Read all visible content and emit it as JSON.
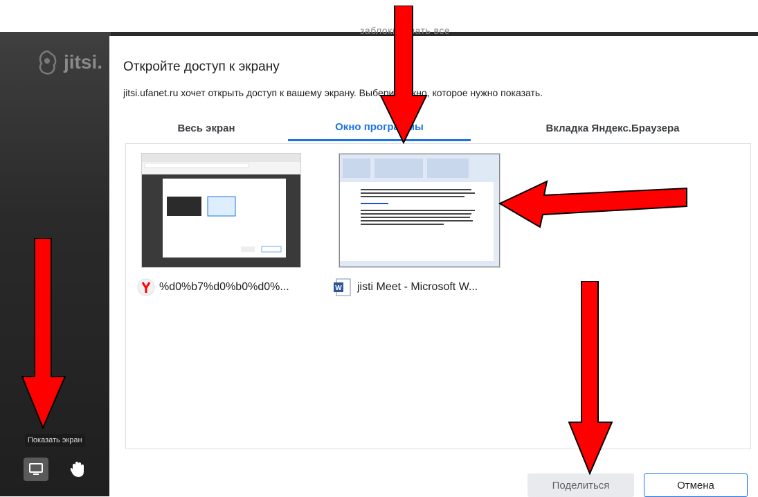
{
  "background": {
    "logo_text": "jitsi.",
    "behind_text": "заблокировать все",
    "tooltip": "Показать экран"
  },
  "dialog": {
    "title": "Откройте доступ к экрану",
    "subtitle": "jitsi.ufanet.ru хочет открыть доступ к вашему экрану. Выберите окно, которое нужно показать.",
    "tabs": [
      {
        "label": "Весь экран",
        "active": false
      },
      {
        "label": "Окно программы",
        "active": true
      },
      {
        "label": "Вкладка Яндекс.Браузера",
        "active": false
      }
    ],
    "windows": [
      {
        "title": "%d0%b7%d0%b0%d0%...",
        "icon": "yandex-browser-icon"
      },
      {
        "title": "jisti Meet - Microsoft W...",
        "icon": "ms-word-icon"
      }
    ],
    "share_label": "Поделиться",
    "cancel_label": "Отмена"
  },
  "colors": {
    "accent": "#1a73e8",
    "arrow": "#ff0000",
    "yandex": "#ff0000"
  }
}
